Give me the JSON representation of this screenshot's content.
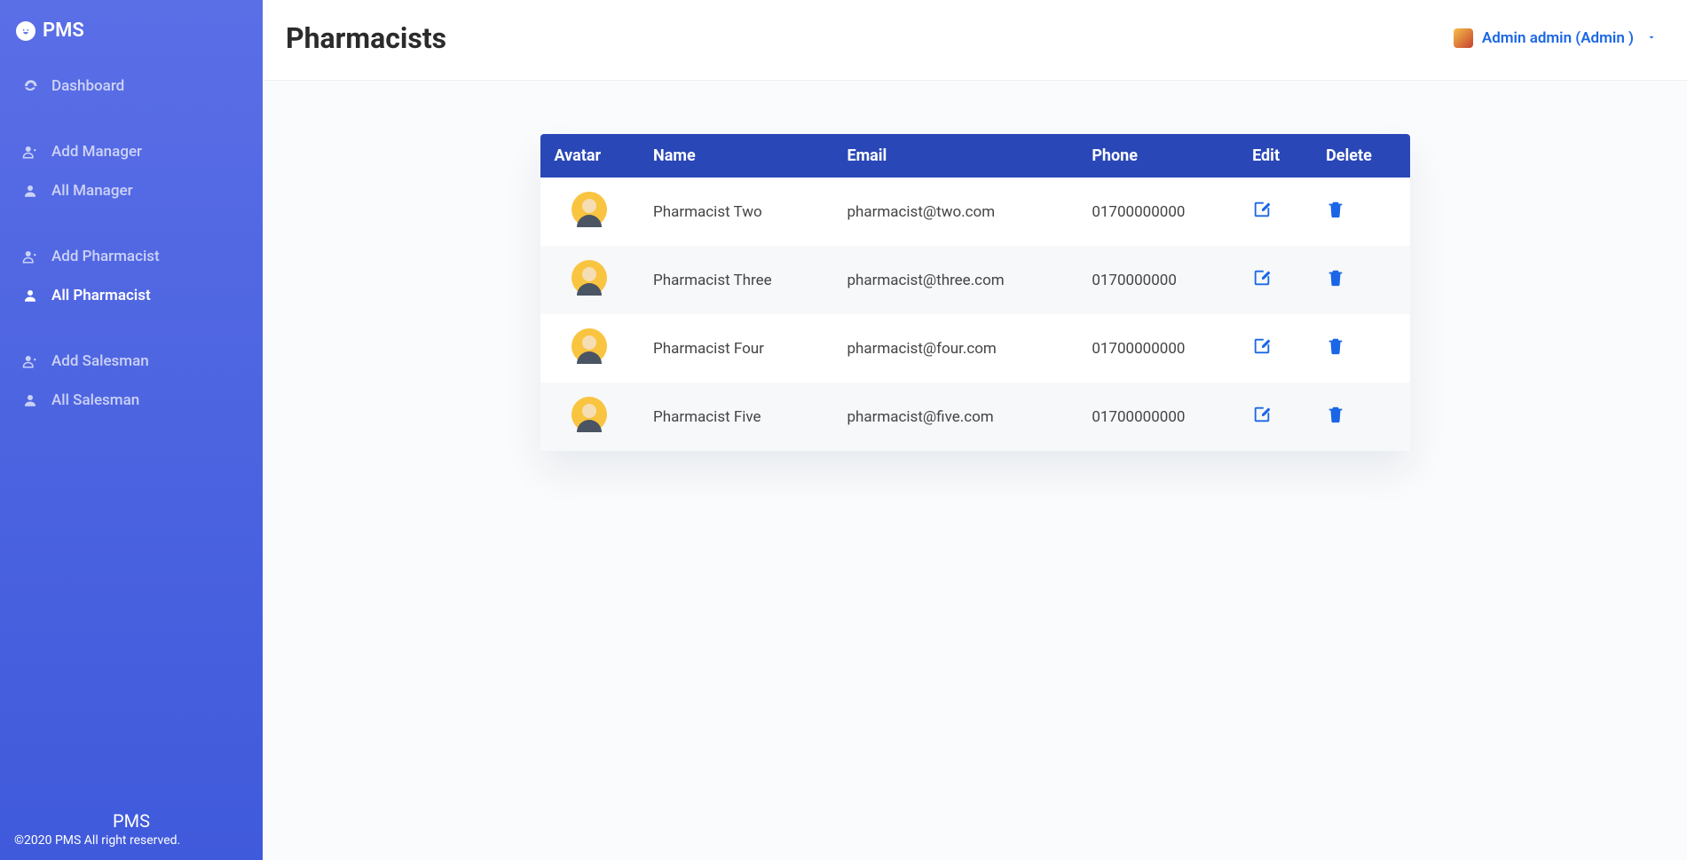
{
  "brand": {
    "name": "PMS"
  },
  "sidebar": {
    "groups": [
      {
        "items": [
          {
            "label": "Dashboard",
            "icon": "dashboard",
            "active": false
          }
        ]
      },
      {
        "items": [
          {
            "label": "Add Manager",
            "icon": "user-plus",
            "active": false
          },
          {
            "label": "All Manager",
            "icon": "user",
            "active": false
          }
        ]
      },
      {
        "items": [
          {
            "label": "Add Pharmacist",
            "icon": "user-plus",
            "active": false
          },
          {
            "label": "All Pharmacist",
            "icon": "user",
            "active": true
          }
        ]
      },
      {
        "items": [
          {
            "label": "Add Salesman",
            "icon": "user-plus",
            "active": false
          },
          {
            "label": "All Salesman",
            "icon": "user",
            "active": false
          }
        ]
      }
    ],
    "footer": {
      "appname": "PMS",
      "copyright": "©2020 PMS All right reserved."
    }
  },
  "header": {
    "title": "Pharmacists",
    "user": "Admin admin (Admin )"
  },
  "table": {
    "columns": [
      "Avatar",
      "Name",
      "Email",
      "Phone",
      "Edit",
      "Delete"
    ],
    "rows": [
      {
        "name": "Pharmacist Two",
        "email": "pharmacist@two.com",
        "phone": "01700000000"
      },
      {
        "name": "Pharmacist Three",
        "email": "pharmacist@three.com",
        "phone": "0170000000"
      },
      {
        "name": "Pharmacist Four",
        "email": "pharmacist@four.com",
        "phone": "01700000000"
      },
      {
        "name": "Pharmacist Five",
        "email": "pharmacist@five.com",
        "phone": "01700000000"
      }
    ]
  }
}
